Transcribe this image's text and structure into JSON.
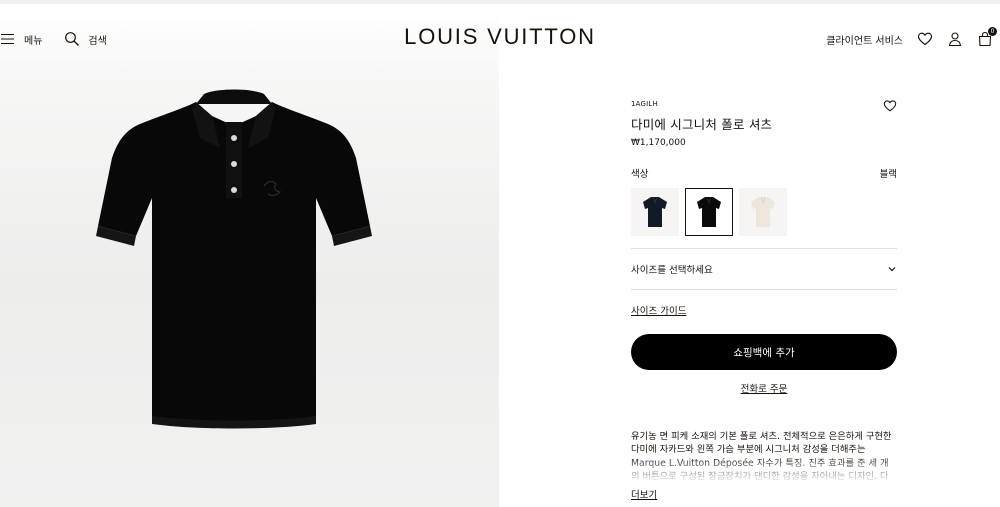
{
  "header": {
    "menu_label": "메뉴",
    "search_label": "검색",
    "logo": "LOUIS VUITTON",
    "client_service": "클라이언트 서비스",
    "bag_count": "0"
  },
  "product": {
    "sku": "1AGILH",
    "title": "다미에 시그니처 폴로 셔츠",
    "price": "₩1,170,000",
    "color_label": "색상",
    "color_value": "블랙",
    "swatches": [
      {
        "name": "navy",
        "color": "#111a26"
      },
      {
        "name": "black",
        "color": "#0a0a0a"
      },
      {
        "name": "cream",
        "color": "#ece6dc"
      }
    ],
    "size_select": "사이즈를 선택하세요",
    "size_guide": "사이즈 가이드",
    "add_to_bag": "쇼핑백에 추가",
    "phone_order": "전화로 주문",
    "description": "유기농 면 피케 소재의 기본 폴로 셔츠. 전체적으로 은은하게 구현한 다미에 자카드와 왼쪽 가슴 부분에 시그니처 감성을 더해주는 Marque L.Vuitton Déposée 자수가 특징. 진주 효과를 준 세 개의 버튼으로 구성된 장금장치가 댄디한 감성을 자아내는 디자인. 다",
    "read_more": "더보기"
  },
  "colors": {
    "text": "#19110b",
    "button_bg": "#000000",
    "divider": "#e1dfdc"
  }
}
